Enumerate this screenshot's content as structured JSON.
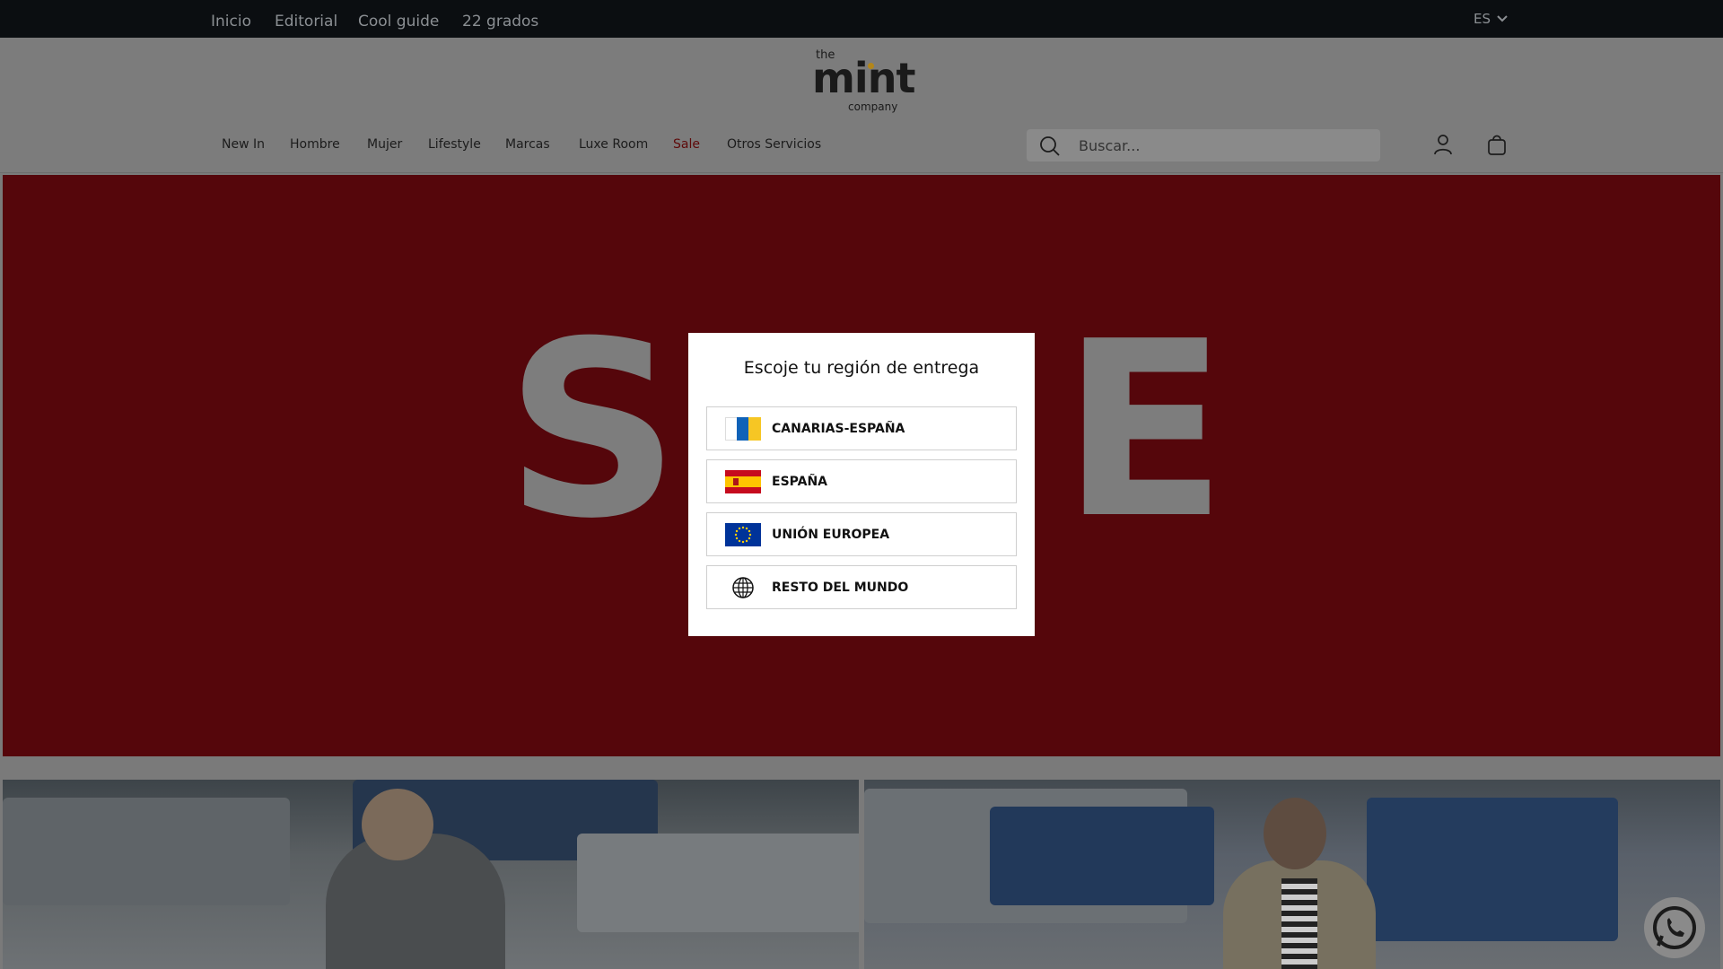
{
  "topbar": {
    "links": [
      "Inicio",
      "Editorial",
      "Cool guide",
      "22 grados"
    ],
    "lang": "ES"
  },
  "logo": {
    "the": "the",
    "mint": "mint",
    "company": "company"
  },
  "nav": {
    "items": [
      "New In",
      "Hombre",
      "Mujer",
      "Lifestyle",
      "Marcas",
      "Luxe Room",
      "Sale",
      "Otros Servicios"
    ],
    "search_placeholder": "Buscar..."
  },
  "hero": {
    "letters": [
      "S",
      "E"
    ],
    "color": "#55060b"
  },
  "modal": {
    "title": "Escoje tu región de entrega",
    "options": [
      {
        "label": "CANARIAS-ESPAÑA",
        "icon": "canary-islands-flag-icon"
      },
      {
        "label": "ESPAÑA",
        "icon": "spain-flag-icon"
      },
      {
        "label": "UNIÓN EUROPEA",
        "icon": "eu-flag-icon"
      },
      {
        "label": "RESTO DEL MUNDO",
        "icon": "globe-icon"
      }
    ]
  }
}
